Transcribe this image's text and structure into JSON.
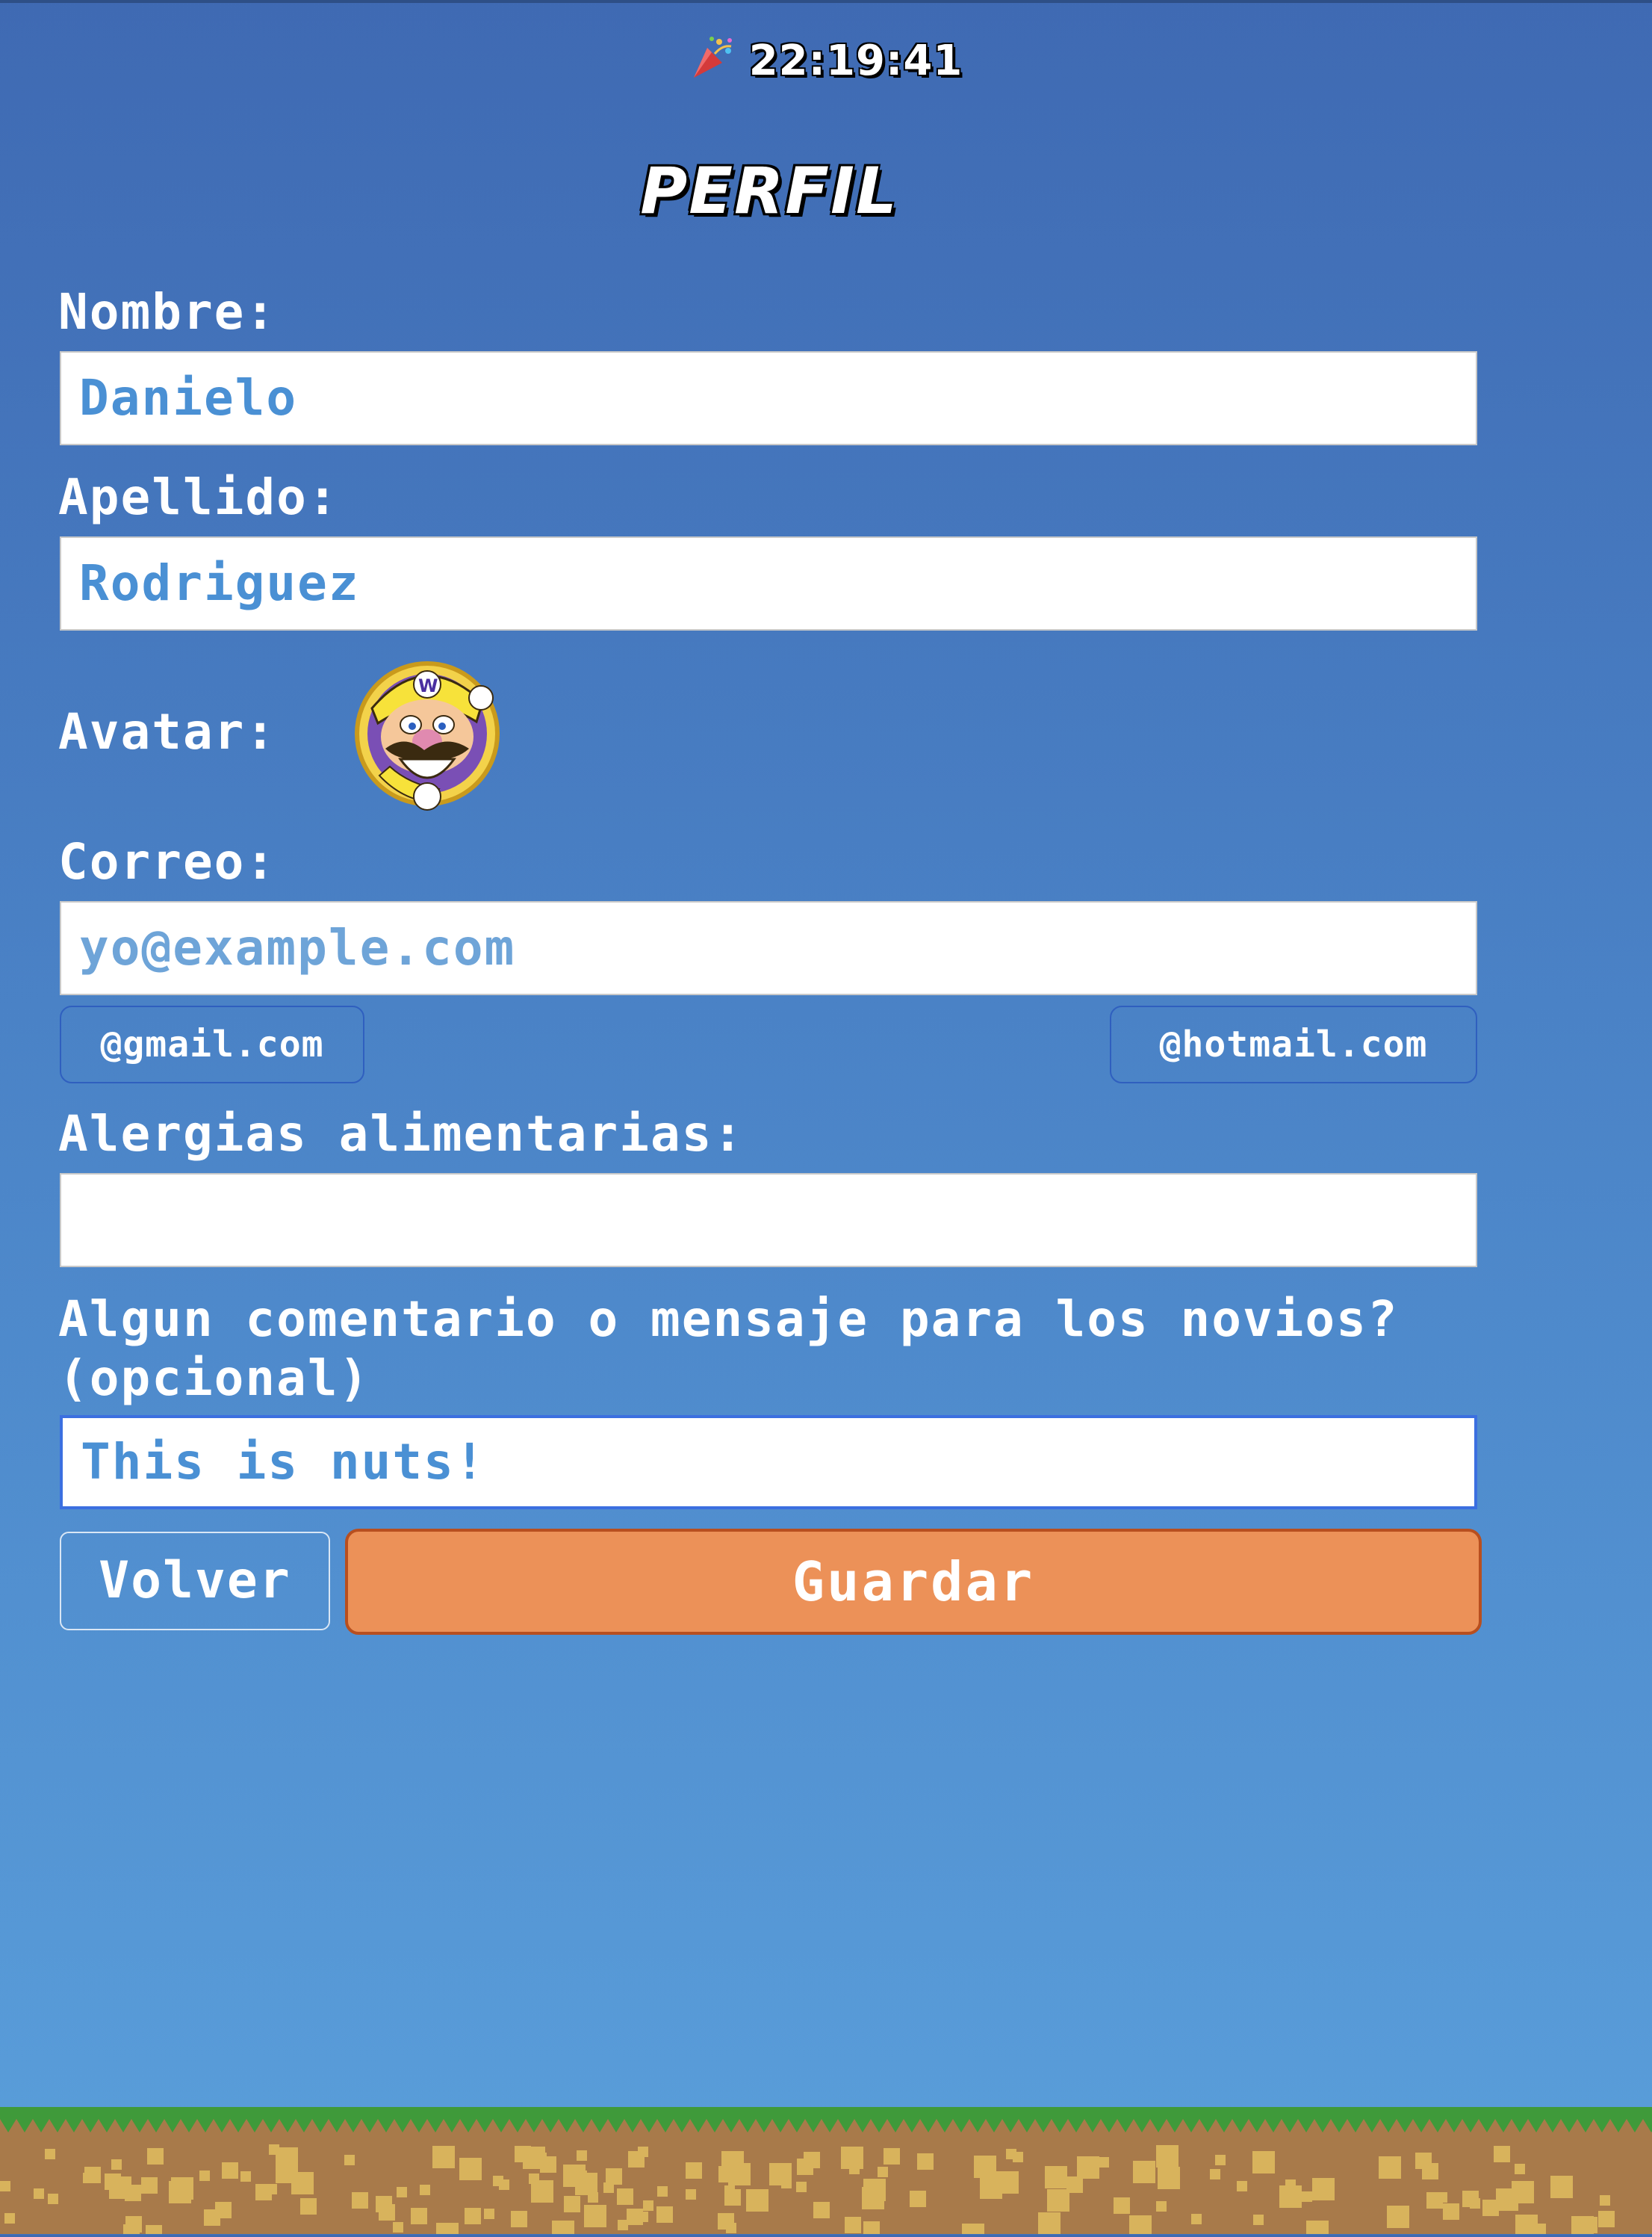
{
  "header": {
    "clock": "22:19:41",
    "clock_icon": "party-popper-icon",
    "title": "PERFIL"
  },
  "form": {
    "nombre": {
      "label": "Nombre:",
      "value": "Danielo"
    },
    "apellido": {
      "label": "Apellido:",
      "value": "Rodriguez"
    },
    "avatar": {
      "label": "Avatar:",
      "icon": "wario-avatar-icon"
    },
    "correo": {
      "label": "Correo:",
      "value": "",
      "placeholder": "yo@example.com",
      "suggestions": [
        "@gmail.com",
        "@hotmail.com"
      ]
    },
    "alergias": {
      "label": "Alergias alimentarias:",
      "value": ""
    },
    "comentario": {
      "label": "Algun comentario o mensaje para los novios? (opcional)",
      "value": "This is nuts!"
    }
  },
  "actions": {
    "back_label": "Volver",
    "save_label": "Guardar"
  },
  "colors": {
    "sky_top": "#3f6ab3",
    "sky_bottom": "#5a9fdb",
    "input_text": "#4a90d4",
    "save_button": "#ec9158",
    "save_border": "#b84f1f",
    "grass": "#3f9a3a",
    "dirt": "#a87a4a"
  }
}
